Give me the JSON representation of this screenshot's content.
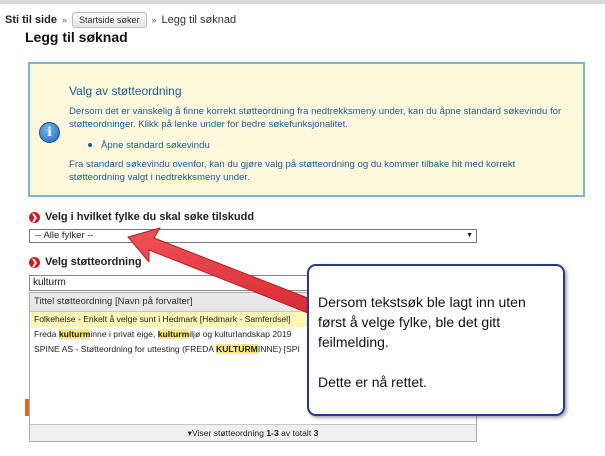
{
  "breadcrumb": {
    "prefix": "Sti til side",
    "separator": "»",
    "button_label": "Startside søker",
    "current": "Legg til søknad"
  },
  "page": {
    "title": "Legg til søknad"
  },
  "info": {
    "icon": "info-icon",
    "title": "Valg av støtteordning",
    "paragraph1": "Dersom det er vanskelig å finne korrekt støtteordning fra nedtrekksmeny under, kan du åpne standard søkevindu for støtteordninger. Klikk på lenke under for bedre søkefunksjonalitet.",
    "link_label": "Åpne standard søkevindu",
    "paragraph2": "Fra standard søkevindu ovenfor, kan du gjøre valg på støtteordning og du kommer tilbake hit med korrekt støtteordning valgt i nedtrekksmeny under."
  },
  "fylke": {
    "label": "Velg i hvilket fylke du skal søke tilskudd",
    "selected": "-- Alle fylker --"
  },
  "stotte": {
    "label": "Velg støtteordning",
    "search_value": "kulturm",
    "header": "Tittel støtteordning [Navn på forvalter]",
    "results": [
      {
        "before": "Folkehelse - Enkelt å velge sunt i Hedmark [Hedmark - Samferdsel]",
        "match": "",
        "after": ""
      },
      {
        "before": "Freda ",
        "match": "kulturm",
        "after": "inne i privat eige, ",
        "match2": "kulturm",
        "after2": "iljø og kulturlandskap 2019"
      },
      {
        "before": "SPINE AS - Støtteordning for uttesting (FREDA ",
        "match": "KULTURM",
        "after": "INNE) [SPI"
      }
    ],
    "footer_prefix": "Viser støtteordning ",
    "footer_range": "1-3",
    "footer_middle": " av totalt ",
    "footer_total": "3"
  },
  "callout": {
    "line1": "Dersom tekstsøk ble lagt inn uten først å velge fylke, ble det gitt feilmelding.",
    "line2": "Dette er nå rettet."
  },
  "colors": {
    "accent_blue": "#1a5f96",
    "info_bg": "#fdf8dc",
    "info_border": "#7fb3d5",
    "required_red": "#cc1f1f",
    "arrow_red": "#e8383f",
    "callout_border": "#253a8a",
    "highlight": "#fbe97a"
  }
}
